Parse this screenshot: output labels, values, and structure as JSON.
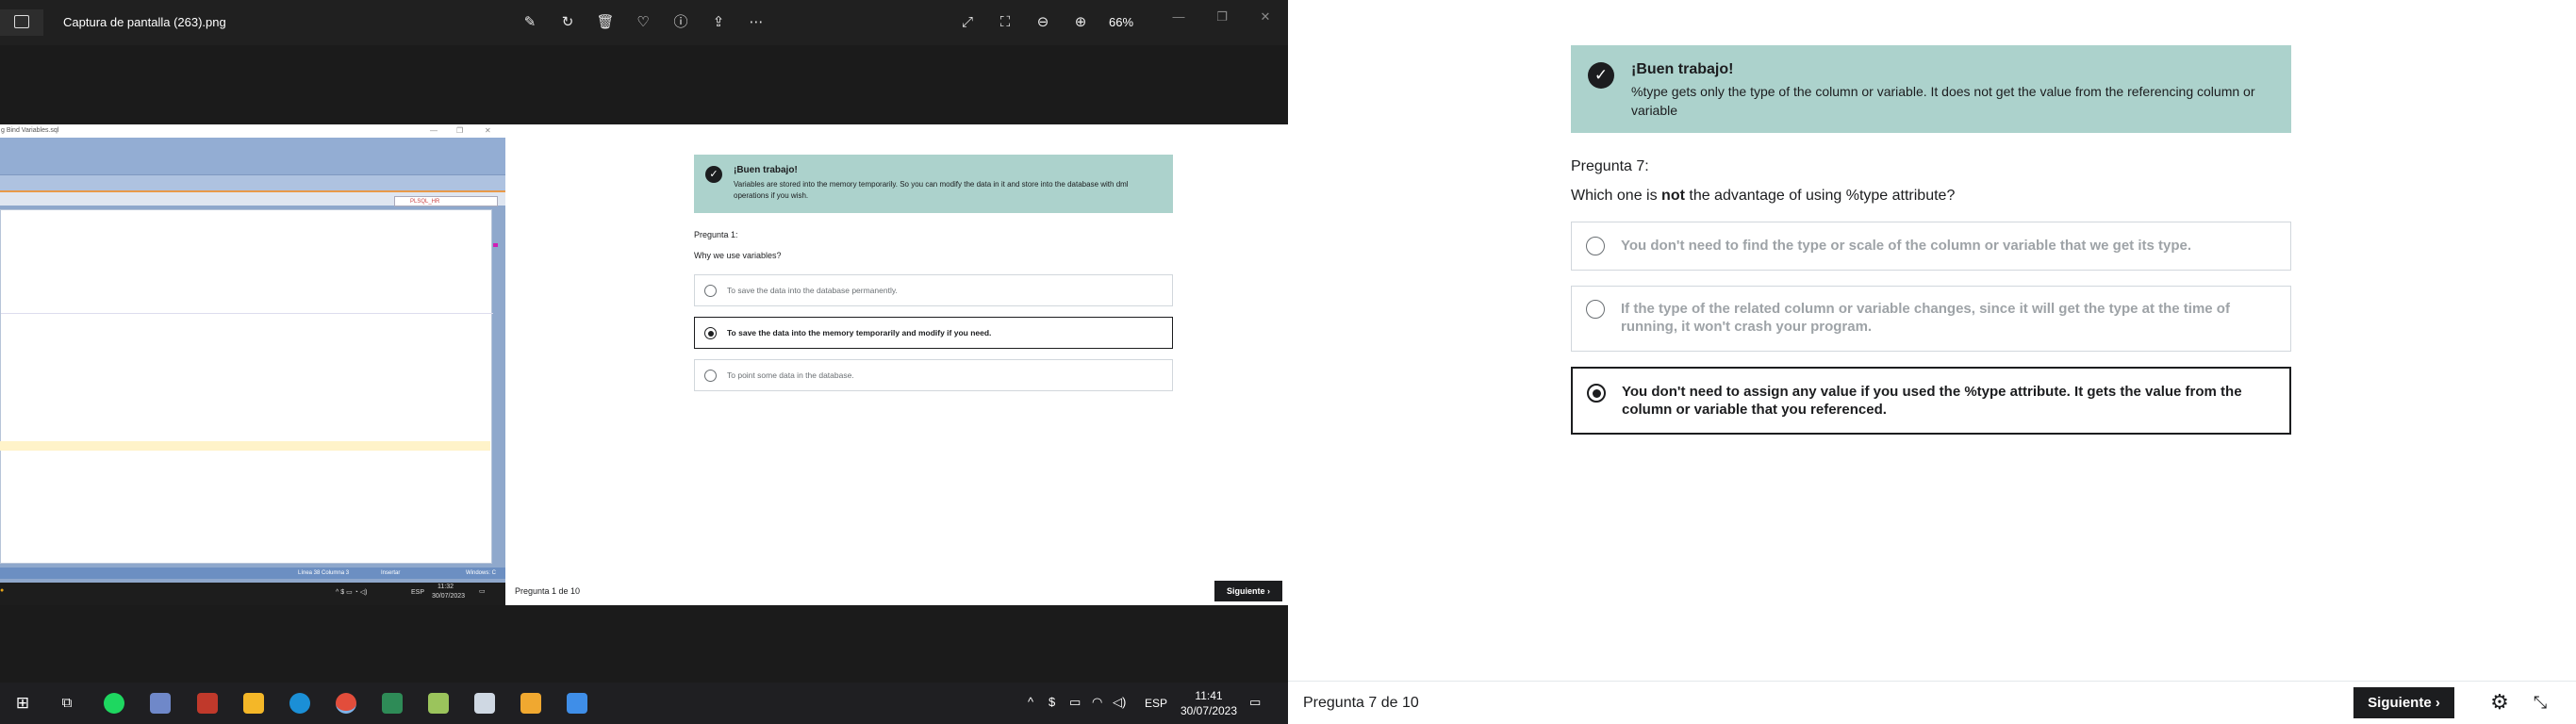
{
  "viewer": {
    "file_name": "Captura de pantalla (263).png",
    "zoom": "66%",
    "icons": [
      "edit-icon",
      "rotate-icon",
      "delete-icon",
      "favorite-icon",
      "info-icon",
      "share-icon",
      "more-icon",
      "fullscreen-icon",
      "fit-icon",
      "zoom-out-icon",
      "zoom-in-icon"
    ],
    "embedded": {
      "ide_title": "g Bind Variables.sql",
      "ide_combo": "PLSQL_HR",
      "ide_status": [
        "Línea 38 Columna 3",
        "Insertar",
        "Windows: C"
      ],
      "taskbar_lang": "ESP",
      "taskbar_time": "11:32",
      "taskbar_date": "30/07/2023",
      "quiz": {
        "alert_title": "¡Buen trabajo!",
        "alert_text": "Variables are stored into the memory temporarily. So you can modify the data in it and store into the database with dml operations if you wish.",
        "question_number": "Pregunta 1:",
        "question_text": "Why we use variables?",
        "options": [
          {
            "label": "To save the data into the database permanently.",
            "selected": false
          },
          {
            "label": "To save the data into the memory temporarily and modify if you need.",
            "selected": true
          },
          {
            "label": "To point some data in the database.",
            "selected": false
          }
        ],
        "progress": "Pregunta 1 de 10",
        "next_label": "Siguiente"
      }
    }
  },
  "taskbar": {
    "apps": [
      "windows-start-icon",
      "task-view-icon",
      "spotify-icon",
      "notes-icon",
      "app-icon",
      "file-explorer-icon",
      "edge-icon",
      "chrome-icon",
      "calendar-icon",
      "notepad-icon",
      "box-icon",
      "photos-icon",
      "photo-viewer-icon"
    ],
    "lang": "ESP",
    "time": "11:41",
    "date": "30/07/2023"
  },
  "quiz": {
    "alert_title": "¡Buen trabajo!",
    "alert_text": "%type gets only the type of the column or variable. It does not get the value from the referencing column or variable",
    "question_number": "Pregunta 7:",
    "question_pre": "Which one is ",
    "question_bold": "not",
    "question_post": " the advantage of using %type attribute?",
    "options": [
      {
        "label": "You don't need to find the type or scale of the column or variable that we get its type.",
        "selected": false
      },
      {
        "label": "If the type of the related column or variable changes, since it will get the type at the time of running, it won't crash your program.",
        "selected": false
      },
      {
        "label": "You don't need to assign any value if you used the %type attribute. It gets the value from the column or variable that you referenced.",
        "selected": true
      }
    ],
    "progress": "Pregunta 7 de 10",
    "next_label": "Siguiente"
  },
  "colors": {
    "alert_bg": "#acd2cc",
    "dark": "#1c1d1f",
    "muted": "#9ea3a7"
  }
}
